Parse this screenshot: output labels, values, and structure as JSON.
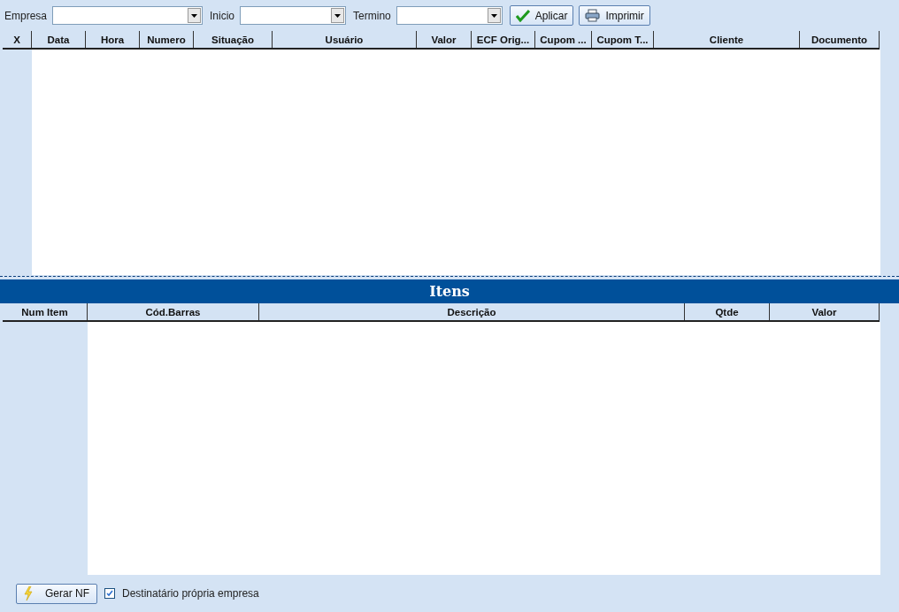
{
  "filters": [
    {
      "label": "Empresa"
    },
    {
      "label": "Inicio"
    },
    {
      "label": "Termino"
    }
  ],
  "toolbar_buttons": [
    {
      "label": "Aplicar",
      "kind": "check"
    },
    {
      "label": "Imprimir",
      "kind": "print"
    }
  ],
  "main_table": {
    "columns": [
      "X",
      "Data",
      "Hora",
      "Numero",
      "Situação",
      "Usuário",
      "Valor",
      "ECF Orig...",
      "Cupom ...",
      "Cupom T...",
      "Cliente",
      "Documento"
    ]
  },
  "items_panel": {
    "title": "Itens",
    "columns": [
      "Num Item",
      "Cód.Barras",
      "Descrição",
      "Qtde",
      "Valor"
    ]
  },
  "footer": {
    "button": {
      "label": "Gerar NF"
    },
    "checkbox": {
      "label": "Destinatário própria empresa",
      "checked": true
    }
  }
}
